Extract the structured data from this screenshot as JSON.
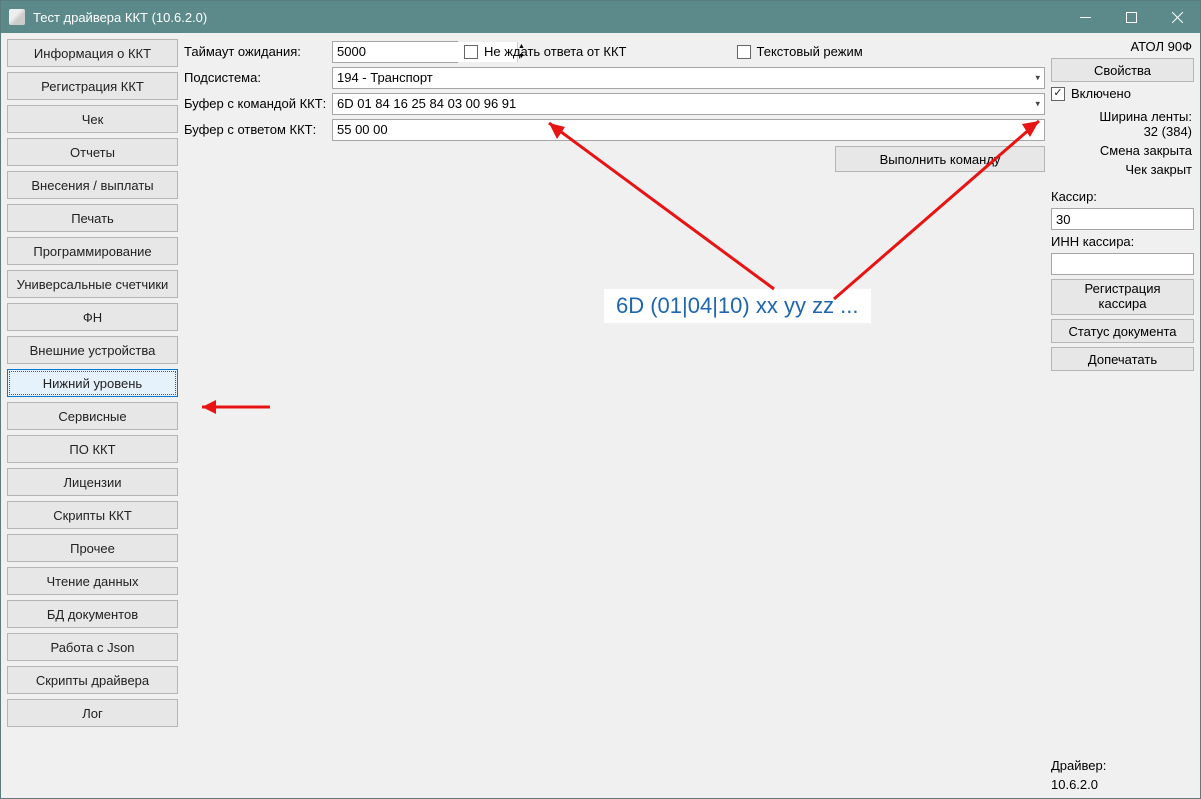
{
  "window": {
    "title": "Тест драйвера ККТ (10.6.2.0)"
  },
  "sidebar": {
    "items": [
      "Информация о ККТ",
      "Регистрация ККТ",
      "Чек",
      "Отчеты",
      "Внесения / выплаты",
      "Печать",
      "Программирование",
      "Универсальные счетчики",
      "ФН",
      "Внешние устройства",
      "Нижний уровень",
      "Сервисные",
      "ПО ККТ",
      "Лицензии",
      "Скрипты ККТ",
      "Прочее",
      "Чтение данных",
      "БД документов",
      "Работа с Json",
      "Скрипты драйвера",
      "Лог"
    ],
    "selected_index": 10
  },
  "form": {
    "timeout_label": "Таймаут ожидания:",
    "timeout_value": "5000",
    "nowait_label": "Не ждать ответа от ККТ",
    "nowait_checked": false,
    "textmode_label": "Текстовый режим",
    "textmode_checked": false,
    "subsystem_label": "Подсистема:",
    "subsystem_value": "194 - Транспорт",
    "cmd_buffer_label": "Буфер с командой ККТ:",
    "cmd_buffer_value": "6D 01 84 16 25 84 03 00 96 91",
    "resp_buffer_label": "Буфер с ответом ККТ:",
    "resp_buffer_value": "55 00 00",
    "execute_label": "Выполнить команду"
  },
  "right": {
    "device_model": "АТОЛ 90Ф",
    "properties_btn": "Свойства",
    "enabled_label": "Включено",
    "enabled_checked": true,
    "tape_width_label": "Ширина ленты:",
    "tape_width_value": "32 (384)",
    "shift_status": "Смена закрыта",
    "check_status": "Чек закрыт",
    "cashier_label": "Кассир:",
    "cashier_value": "30",
    "cashier_inn_label": "ИНН кассира:",
    "cashier_inn_value": "",
    "register_cashier_btn": "Регистрация\nкассира",
    "doc_status_btn": "Статус документа",
    "reprint_btn": "Допечатать",
    "driver_label": "Драйвер:",
    "driver_version": "10.6.2.0"
  },
  "annotation": {
    "text": "6D (01|04|10) xx yy zz ..."
  }
}
